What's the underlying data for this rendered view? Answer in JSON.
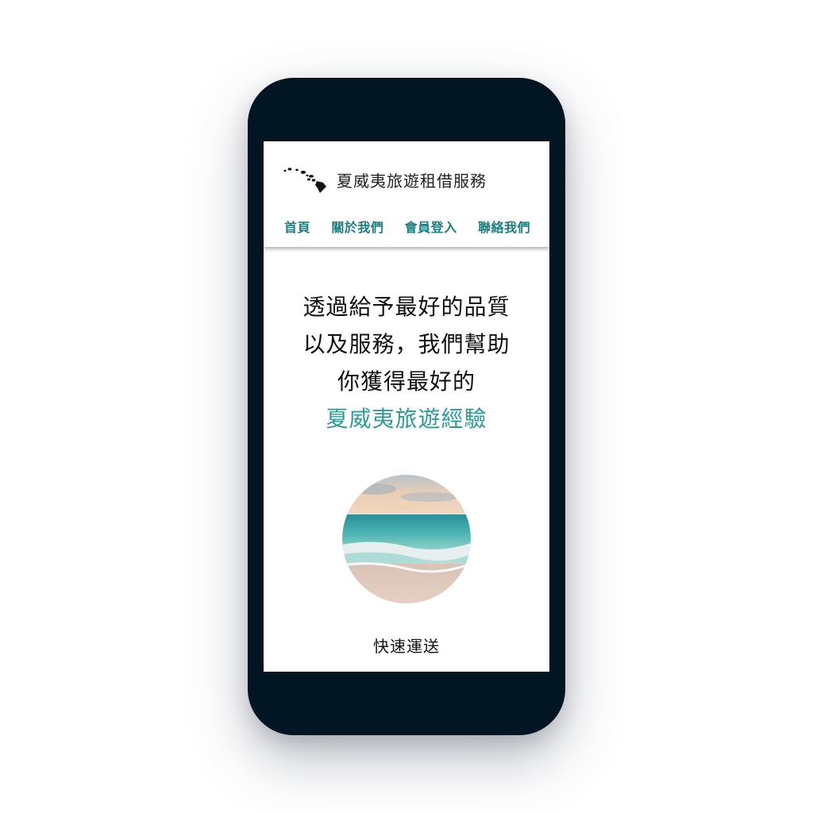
{
  "brand": {
    "logo_icon": "hawaiian-islands-icon",
    "name": "夏威夷旅遊租借服務"
  },
  "nav": {
    "items": [
      {
        "label": "首頁"
      },
      {
        "label": "關於我們"
      },
      {
        "label": "會員登入"
      },
      {
        "label": "聯絡我們"
      }
    ]
  },
  "hero": {
    "lines": [
      "透過給予最好的品質",
      "以及服務，我們幫助",
      "你獲得最好的"
    ],
    "accent": "夏威夷旅遊經驗"
  },
  "feature": {
    "image": "beach-sunset-photo",
    "caption": "快速運送"
  },
  "colors": {
    "phone_frame": "#011522",
    "accent": "#2a9d95",
    "nav_link": "#1a7f80"
  }
}
